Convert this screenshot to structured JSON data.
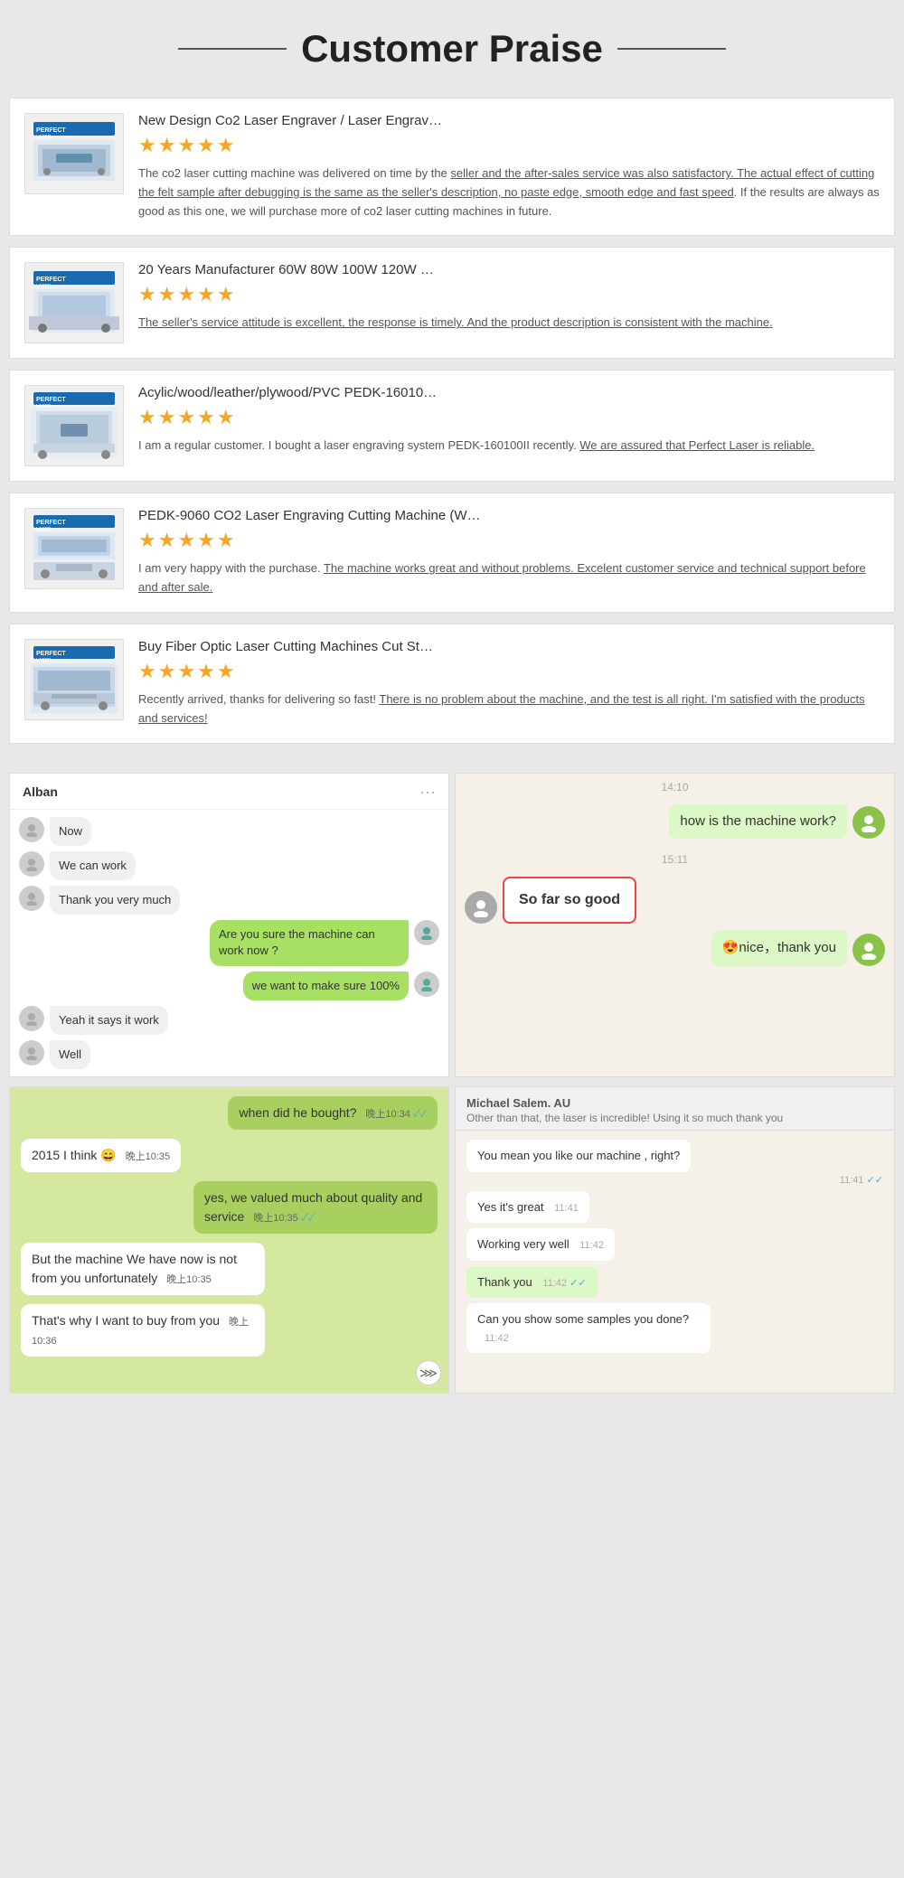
{
  "header": {
    "title": "Customer Praise"
  },
  "reviews": [
    {
      "id": "review-1",
      "title": "New Design Co2 Laser Engraver / Laser Engrav…",
      "stars": "★★★★★",
      "text_plain": "The co2 laser cutting machine was delivered on time by the ",
      "text_underline": "seller and the after-sales service was also satisfactory. The actual effect of cutting the felt sample after debugging is the same as the seller's description, no paste edge, smooth edge and fast speed",
      "text_after": ". If the results are always as good as this one, we will purchase more of co2 laser cutting machines in future."
    },
    {
      "id": "review-2",
      "title": "20 Years Manufacturer 60W 80W 100W 120W …",
      "stars": "★★★★★",
      "text_plain": "",
      "text_underline": "The seller's service attitude is excellent, the response is timely. And the product description is consistent with the machine.",
      "text_after": ""
    },
    {
      "id": "review-3",
      "title": "Acylic/wood/leather/plywood/PVC PEDK-16010…",
      "stars": "★★★★★",
      "text_plain": "I am a regular customer. I bought a laser engraving system PEDK-160100II recently. ",
      "text_underline": "We are assured that Perfect Laser is reliable.",
      "text_after": ""
    },
    {
      "id": "review-4",
      "title": "PEDK-9060 CO2 Laser Engraving Cutting Machine (W…",
      "stars": "★★★★★",
      "text_plain": "I am very happy with the purchase. ",
      "text_underline": "The machine works great and without problems. Excelent customer service and technical support before and after sale.",
      "text_after": ""
    },
    {
      "id": "review-5",
      "title": "Buy Fiber Optic Laser Cutting Machines Cut St…",
      "stars": "★★★★★",
      "text_plain": "Recently arrived, thanks for delivering so fast! ",
      "text_underline": "There is no problem about the machine, and the test is all right. I'm satisfied with the products and services!",
      "text_after": ""
    }
  ],
  "chat_left": {
    "contact_name": "Alban",
    "messages": [
      {
        "id": "m1",
        "side": "left",
        "text": "Now"
      },
      {
        "id": "m2",
        "side": "left",
        "text": "We can work"
      },
      {
        "id": "m3",
        "side": "left",
        "text": "Thank you very much"
      },
      {
        "id": "m4",
        "side": "right",
        "text": "Are you sure the machine can work now ?",
        "type": "green"
      },
      {
        "id": "m5",
        "side": "right",
        "text": "we want to make sure 100%",
        "type": "green"
      },
      {
        "id": "m6",
        "side": "left",
        "text": "Yeah it says it work"
      },
      {
        "id": "m7",
        "side": "left",
        "text": "Well"
      }
    ]
  },
  "chat_right": {
    "time1": "14:10",
    "time2": "15:11",
    "messages": [
      {
        "id": "wr1",
        "side": "right",
        "text": "how is the machine work?",
        "type": "sent"
      },
      {
        "id": "wr2",
        "side": "left",
        "text": "So far so good",
        "type": "recv-red"
      },
      {
        "id": "wr3",
        "side": "right",
        "text": "😍nice，thank you",
        "type": "sent"
      }
    ]
  },
  "chat_bottom_left": {
    "messages": [
      {
        "id": "bl1",
        "side": "sent",
        "text": "when did he bought?",
        "time": "晚上10:34",
        "check": "✓✓"
      },
      {
        "id": "bl2",
        "side": "recv",
        "text": "2015 I think 😄",
        "time": "晚上10:35"
      },
      {
        "id": "bl3",
        "side": "sent",
        "text": "yes, we valued much about quality and service",
        "time": "晚上10:35",
        "check": "✓✓"
      },
      {
        "id": "bl4",
        "side": "recv",
        "text": "But the machine We have now is not from you unfortunately",
        "time": "晚上10:35"
      },
      {
        "id": "bl5",
        "side": "recv",
        "text": "That's why I want to buy from you",
        "time": "晚上10:36"
      }
    ]
  },
  "chat_bottom_right": {
    "customer_name": "Michael Salem. AU",
    "customer_desc": "Other than that, the laser is incredible! Using it so much thank you",
    "messages": [
      {
        "id": "br1",
        "type": "recv",
        "text": "You mean you like our machine , right?",
        "time": "11:41",
        "check": "✓✓"
      },
      {
        "id": "br2",
        "type": "recv",
        "text": "Yes it's great",
        "time": "11:41"
      },
      {
        "id": "br3",
        "type": "recv",
        "text": "Working very well",
        "time": "11:42"
      },
      {
        "id": "br4",
        "type": "sent",
        "text": "Thank you",
        "time": "11:42",
        "check": "✓✓"
      },
      {
        "id": "br5",
        "type": "recv",
        "text": "Can you show some samples you done?",
        "time": "11:42"
      }
    ]
  },
  "icons": {
    "star": "★",
    "dots": "···",
    "scroll_down": "⋙",
    "check_blue": "✓✓",
    "person": "👤"
  }
}
